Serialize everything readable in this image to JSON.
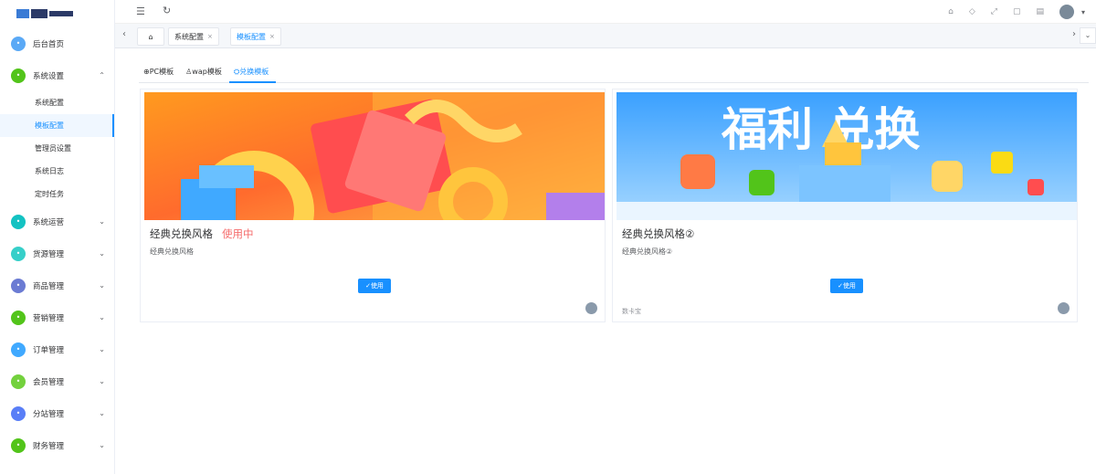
{
  "sidebar": {
    "logo_text": "",
    "items": [
      {
        "label": "后台首页",
        "icon": "home-icon",
        "color": "#5aa9f6"
      },
      {
        "label": "系统设置",
        "icon": "settings-icon",
        "color": "#52c41a",
        "expanded": true,
        "children": [
          "系统配置",
          "模板配置",
          "管理员设置",
          "系统日志",
          "定时任务"
        ],
        "active_child": "模板配置"
      },
      {
        "label": "系统运营",
        "icon": "operation-icon",
        "color": "#13c2c2"
      },
      {
        "label": "货源管理",
        "icon": "supply-icon",
        "color": "#36cfc9"
      },
      {
        "label": "商品管理",
        "icon": "product-icon",
        "color": "#6b7bd3"
      },
      {
        "label": "营销管理",
        "icon": "marketing-icon",
        "color": "#52c41a"
      },
      {
        "label": "订单管理",
        "icon": "order-icon",
        "color": "#40a9ff"
      },
      {
        "label": "会员管理",
        "icon": "member-icon",
        "color": "#73d13d"
      },
      {
        "label": "分站管理",
        "icon": "branch-icon",
        "color": "#597ef7"
      },
      {
        "label": "财务管理",
        "icon": "finance-icon",
        "color": "#52c41a"
      }
    ]
  },
  "header": {
    "menu_icon": "menu-fold-icon",
    "refresh_icon": "refresh-icon",
    "right_icons": [
      "home-icon",
      "tag-icon",
      "fullscreen-icon",
      "lock-icon",
      "trash-icon"
    ],
    "user_name": ""
  },
  "tabs": [
    {
      "label": "",
      "icon": "home-icon"
    },
    {
      "label": "系统配置"
    },
    {
      "label": "模板配置",
      "active": true
    }
  ],
  "subtabs": [
    {
      "label": "PC模板",
      "icon": "globe-icon"
    },
    {
      "label": "wap模板",
      "icon": "user-icon"
    },
    {
      "label": "兑换模板",
      "icon": "gift-icon",
      "active": true
    }
  ],
  "cards": [
    {
      "title": "经典兑换风格",
      "status": "使用中",
      "desc": "经典兑换风格",
      "button": "使用",
      "footer": "",
      "corner": ""
    },
    {
      "title": "经典兑换风格②",
      "status": "",
      "desc": "经典兑换风格②",
      "button": "使用",
      "footer": "数卡宝",
      "corner": "",
      "banner_text": "福利 兑换"
    }
  ],
  "colors": {
    "accent": "#1890ff",
    "status_red": "#f56c6c"
  }
}
